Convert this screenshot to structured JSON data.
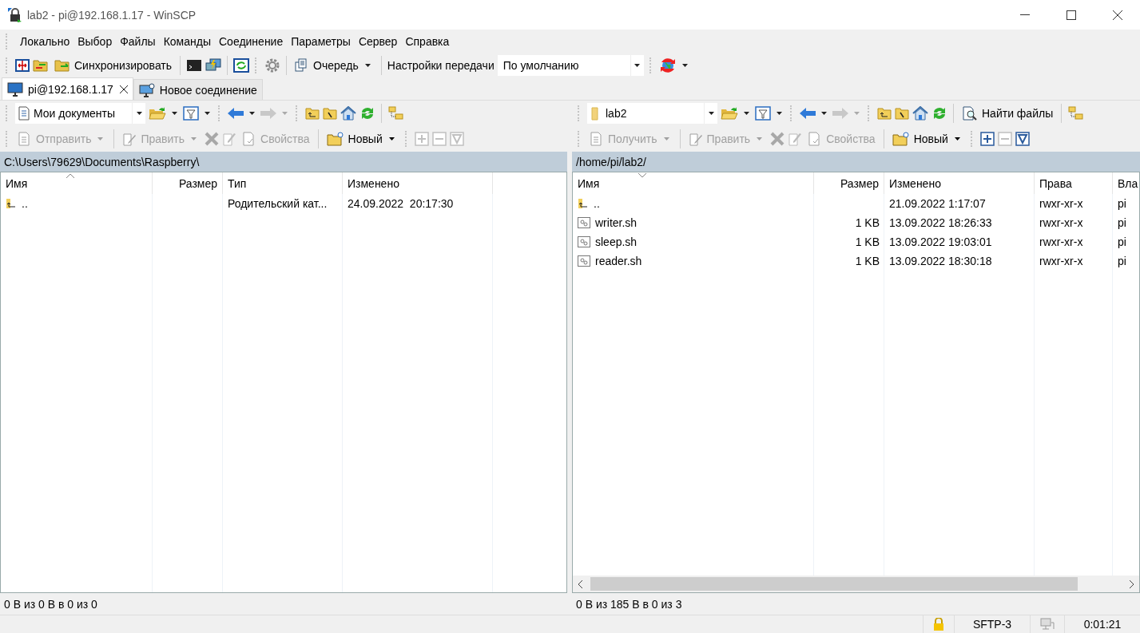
{
  "window": {
    "title": "lab2 - pi@192.168.1.17 - WinSCP"
  },
  "menu": [
    "Локально",
    "Выбор",
    "Файлы",
    "Команды",
    "Соединение",
    "Параметры",
    "Сервер",
    "Справка"
  ],
  "main_toolbar": {
    "sync_button": "Синхронизировать",
    "queue_button": "Очередь",
    "transfer_label": "Настройки передачи",
    "transfer_preset": "По умолчанию"
  },
  "tabs": [
    {
      "label": "pi@192.168.1.17",
      "selected": true,
      "closable": true
    },
    {
      "label": "Новое соединение",
      "selected": false,
      "closable": false
    }
  ],
  "panels": [
    {
      "location": "Мои документы",
      "kind": "local",
      "actions": [
        {
          "label": "Отправить",
          "disabled": true
        },
        {
          "label": "Править",
          "disabled": true
        },
        {
          "label": "Свойства",
          "disabled": true
        },
        {
          "label": "Новый",
          "disabled": false
        }
      ],
      "mask_buttons": [
        {
          "disabled": true
        },
        {
          "disabled": true
        },
        {
          "disabled": true
        }
      ],
      "path": "C:\\Users\\79629\\Documents\\Raspberry\\",
      "columns": [
        {
          "label": "Имя",
          "sort_ascending": true
        },
        {
          "label": "Размер"
        },
        {
          "label": "Тип"
        },
        {
          "label": "Изменено"
        }
      ],
      "rows": [
        {
          "kind": "parent",
          "cells": [
            "..",
            null,
            "Родительский кат...",
            "24.09.2022  20:17:30"
          ]
        }
      ],
      "status": "0 B из 0 B в 0 из 0"
    },
    {
      "location": "lab2",
      "kind": "remote",
      "find_button": "Найти файлы",
      "horizontal_scrollbar": true,
      "actions": [
        {
          "label": "Получить",
          "disabled": true
        },
        {
          "label": "Править",
          "disabled": true
        },
        {
          "label": "Свойства",
          "disabled": true
        },
        {
          "label": "Новый",
          "disabled": false
        }
      ],
      "mask_buttons": [
        {
          "disabled": false
        },
        {
          "disabled": true
        },
        {
          "disabled": false
        }
      ],
      "path": "/home/pi/lab2/",
      "columns": [
        {
          "label": "Имя",
          "sort_ascending": false
        },
        {
          "label": "Размер"
        },
        {
          "label": "Изменено"
        },
        {
          "label": "Права"
        },
        {
          "label": "Вла"
        }
      ],
      "rows": [
        {
          "kind": "parent",
          "cells": [
            "..",
            null,
            "21.09.2022 1:17:07",
            "rwxr-xr-x",
            "pi"
          ]
        },
        {
          "kind": "script",
          "cells": [
            "writer.sh",
            "1 KB",
            "13.09.2022 18:26:33",
            "rwxr-xr-x",
            "pi"
          ]
        },
        {
          "kind": "script",
          "cells": [
            "sleep.sh",
            "1 KB",
            "13.09.2022 19:03:01",
            "rwxr-xr-x",
            "pi"
          ]
        },
        {
          "kind": "script",
          "cells": [
            "reader.sh",
            "1 KB",
            "13.09.2022 18:30:18",
            "rwxr-xr-x",
            "pi"
          ]
        }
      ],
      "status": "0 B из 185 B в 0 из 3"
    }
  ],
  "status_bar": {
    "protocol": "SFTP-3",
    "elapsed": "0:01:21"
  }
}
